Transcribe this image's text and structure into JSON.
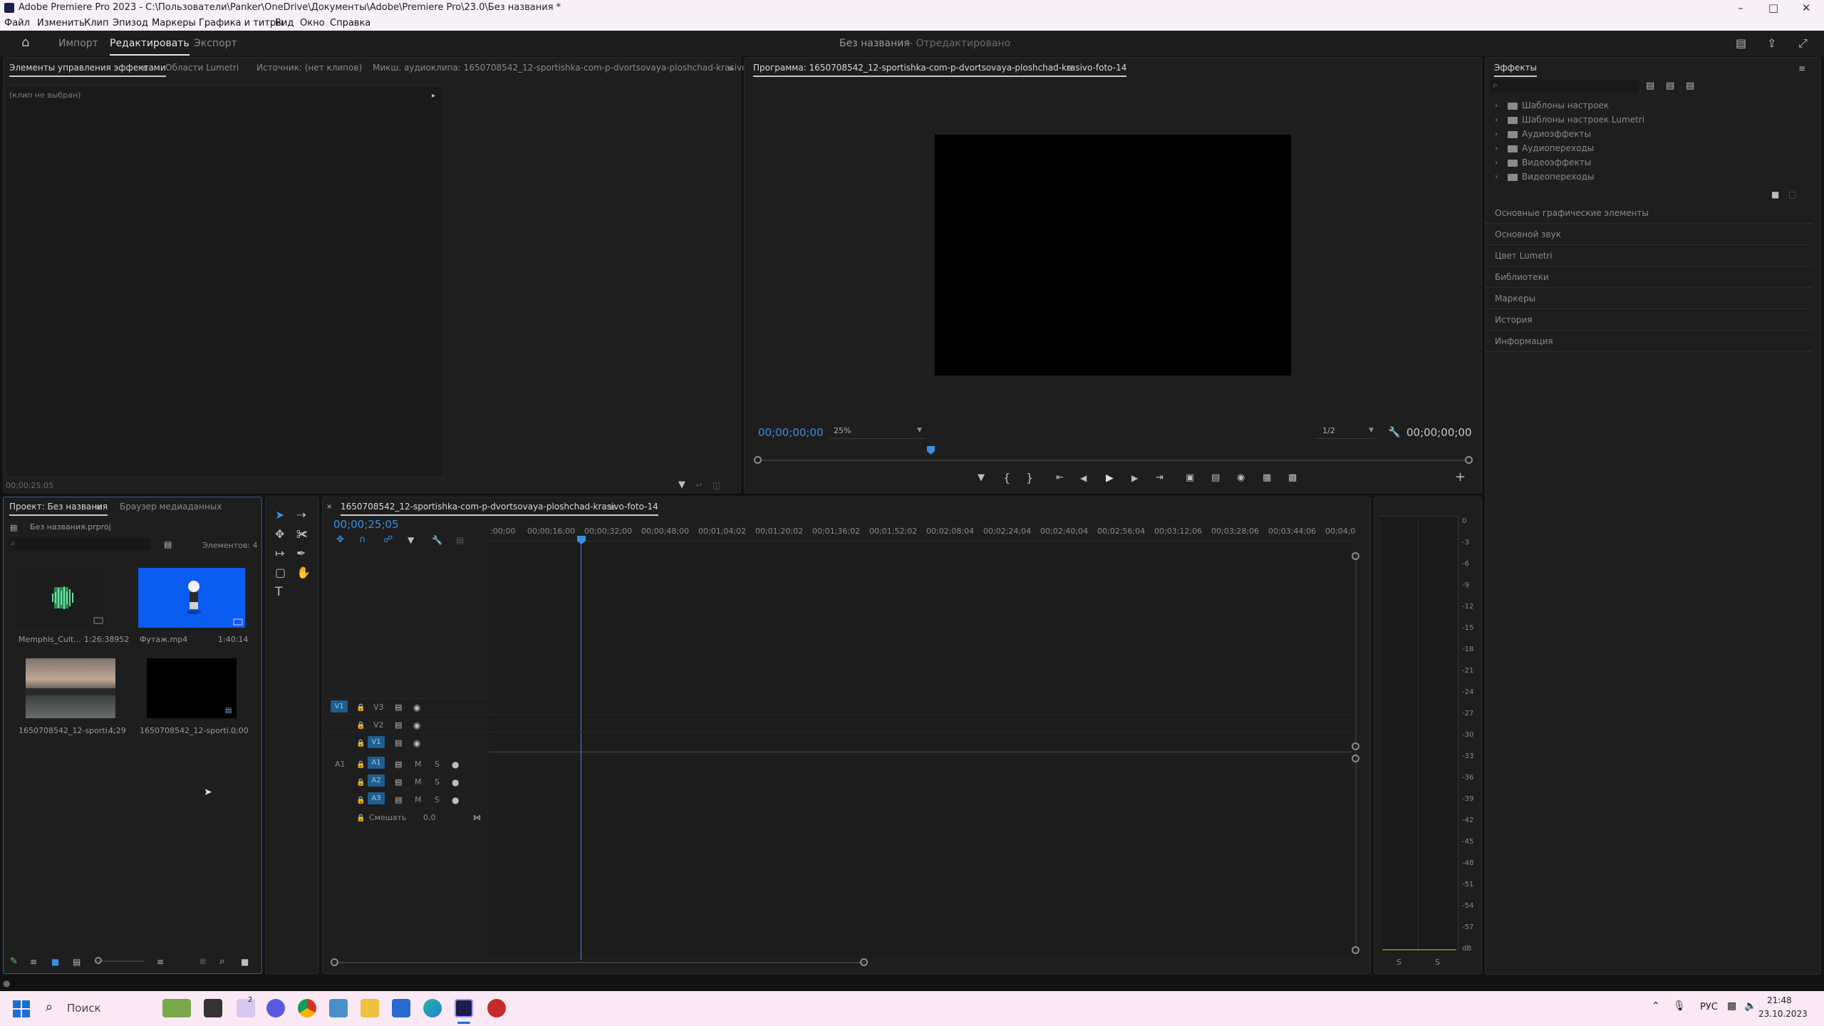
{
  "window": {
    "title": "Adobe Premiere Pro 2023 - C:\\Пользователи\\Panker\\OneDrive\\Документы\\Adobe\\Premiere Pro\\23.0\\Без названия *"
  },
  "menu": [
    "Файл",
    "Изменить",
    "Клип",
    "Эпизод",
    "Маркеры",
    "Графика и титры",
    "Вид",
    "Окно",
    "Справка"
  ],
  "workspace": {
    "tabs": [
      "Импорт",
      "Редактировать",
      "Экспорт"
    ],
    "active": "Редактировать",
    "project_name": "Без названия",
    "status": "- Отредактировано"
  },
  "source_panel": {
    "tabs": [
      "Элементы управления эффектами",
      "Области Lumetri",
      "Источник: (нет клипов)",
      "Микш. аудиоклипа: 1650708542_12-sportishka-com-p-dvortsovaya-ploshchad-krasivo-foto-14"
    ],
    "no_clip": "(клип не выбран)",
    "timecode": "00;00;25;05"
  },
  "program": {
    "title": "Программа: 1650708542_12-sportishka-com-p-dvortsovaya-ploshchad-krasivo-foto-14",
    "timecode_left": "00;00;00;00",
    "zoom": "25%",
    "resolution": "1/2",
    "timecode_right": "00;00;00;00"
  },
  "effects_panel": {
    "title": "Эффекты",
    "folders": [
      "Шаблоны настроек",
      "Шаблоны настроек Lumetri",
      "Аудиоэффекты",
      "Аудиопереходы",
      "Видеоэффекты",
      "Видеопереходы"
    ],
    "sections": [
      "Основные графические элементы",
      "Основной звук",
      "Цвет Lumetri",
      "Библиотеки",
      "Маркеры",
      "История",
      "Информация"
    ]
  },
  "project_panel": {
    "tabs": [
      "Проект: Без названия",
      "Браузер медиаданных"
    ],
    "file": "Без названия.prproj",
    "count": "Элементов: 4",
    "items": [
      {
        "name": "Memphis_Cult...",
        "duration": "1:26:38952"
      },
      {
        "name": "Футаж.mp4",
        "duration": "1:40:14"
      },
      {
        "name": "1650708542_12-sporti...",
        "duration": "4;29"
      },
      {
        "name": "1650708542_12-sporti...",
        "duration": "0;00"
      }
    ]
  },
  "timeline": {
    "title": "1650708542_12-sportishka-com-p-dvortsovaya-ploshchad-krasivo-foto-14",
    "timecode": "00;00;25;05",
    "ruler": [
      ":00;00",
      "00;00;16;00",
      "00;00;32;00",
      "00;00;48;00",
      "00;01;04;02",
      "00;01;20;02",
      "00;01;36;02",
      "00;01;52;02",
      "00;02;08;04",
      "00;02;24;04",
      "00;02;40;04",
      "00;02;56;04",
      "00;03;12;06",
      "00;03;28;06",
      "00;03;44;06",
      "00;04;0"
    ],
    "video_tracks": [
      "V3",
      "V2",
      "V1"
    ],
    "audio_tracks": [
      "A1",
      "A2",
      "A3"
    ],
    "source_v": "V1",
    "source_a": "A1",
    "mix_label": "Смешать",
    "mix_value": "0,0",
    "mute": "M",
    "solo": "S"
  },
  "meter": {
    "scale": [
      "0",
      "-3",
      "-6",
      "-9",
      "-12",
      "-15",
      "-18",
      "-21",
      "-24",
      "-27",
      "-30",
      "-33",
      "-36",
      "-39",
      "-42",
      "-45",
      "-48",
      "-51",
      "-54",
      "-57",
      "dB"
    ],
    "solo_left": "S",
    "solo_right": "S"
  },
  "taskbar": {
    "search": "Поиск",
    "lang": "РУС",
    "time": "21:48",
    "date": "23.10.2023",
    "weather_badge": "2"
  }
}
